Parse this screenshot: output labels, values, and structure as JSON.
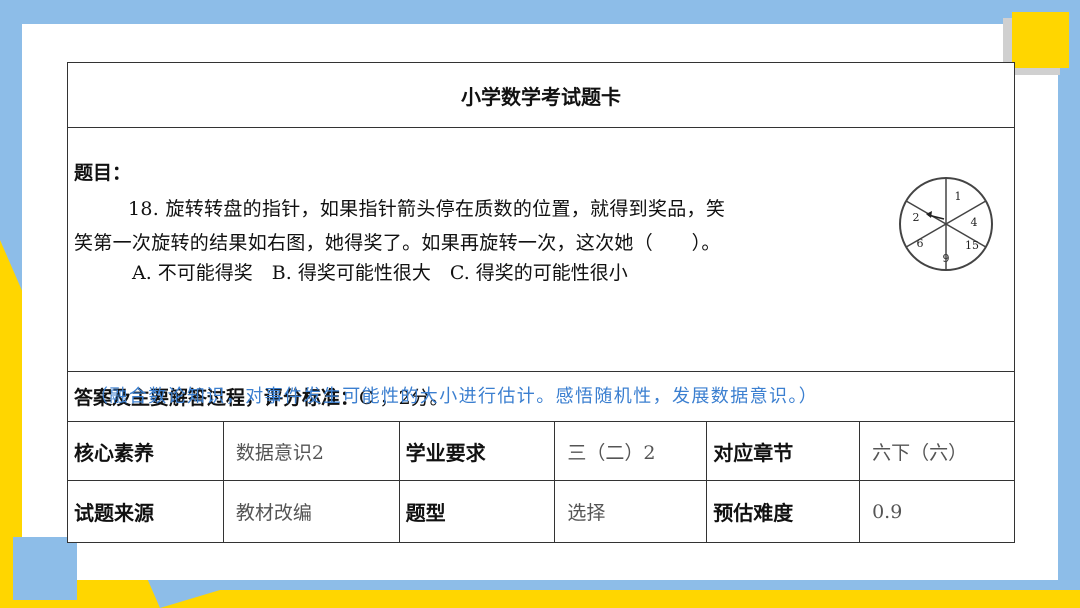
{
  "card": {
    "title": "小学数学考试题卡",
    "question_label": "题目：",
    "question_line1": "18. 旋转转盘的指针，如果指针箭头停在质数的位置，就得到奖品，笑",
    "question_line2": "笑第一次旋转的结果如右图，她得奖了。如果再旋转一次，这次她（　　）。",
    "options": "A. 不可能得奖　B. 得奖可能性很大　C. 得奖的可能性很小",
    "note": "（融合数论知识，对事件发生可能性的大小进行估计。感悟随机性，发展数据意识。）",
    "answer_label": "答案及主要解答过程，评分标准：",
    "answer_value": "C ，2分。",
    "spinner_numbers": [
      "1",
      "4",
      "15",
      "9",
      "6",
      "2"
    ],
    "rows": [
      [
        {
          "label": "核心素养",
          "value": "数据意识2"
        },
        {
          "label": "学业要求",
          "value": "三（二）2"
        },
        {
          "label": "对应章节",
          "value": "六下（六）"
        }
      ],
      [
        {
          "label": "试题来源",
          "value": "教材改编"
        },
        {
          "label": "题型",
          "value": "选择"
        },
        {
          "label": "预估难度",
          "value": "0.9"
        }
      ]
    ]
  },
  "colors": {
    "background_blue": "#8dbde8",
    "accent_yellow": "#ffd600",
    "note_blue": "#3b7fd0"
  }
}
